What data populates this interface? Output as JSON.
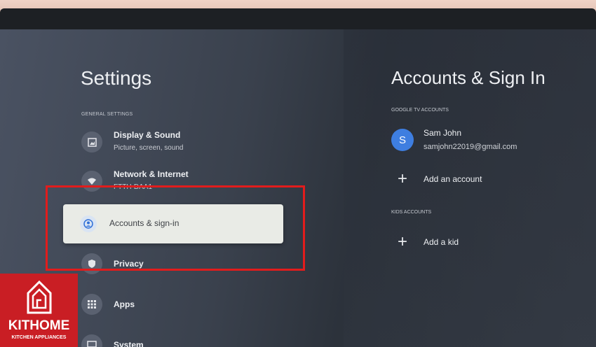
{
  "left": {
    "title": "Settings",
    "section": "GENERAL SETTINGS",
    "items": [
      {
        "label": "Display & Sound",
        "sub": "Picture, screen, sound",
        "icon": "image-icon"
      },
      {
        "label": "Network & Internet",
        "sub": "FTTH-DAA1",
        "icon": "wifi-icon"
      },
      {
        "label": "Accounts & sign-in",
        "icon": "account-icon"
      },
      {
        "label": "Privacy",
        "icon": "shield-icon"
      },
      {
        "label": "Apps",
        "icon": "apps-grid-icon"
      },
      {
        "label": "System",
        "icon": "monitor-icon"
      }
    ]
  },
  "right": {
    "title": "Accounts & Sign In",
    "google_section": "GOOGLE TV ACCOUNTS",
    "account": {
      "initial": "S",
      "name": "Sam John",
      "email": "samjohn22019@gmail.com"
    },
    "add_account": "Add an account",
    "kids_section": "KIDS ACCOUNTS",
    "add_kid": "Add a kid"
  },
  "logo": {
    "name": "KITHOME",
    "tagline": "KITCHEN APPLIANCES"
  },
  "colors": {
    "highlight_box": "#e21c1c",
    "logo_bg": "#c91e24",
    "avatar": "#3e7ee0"
  }
}
